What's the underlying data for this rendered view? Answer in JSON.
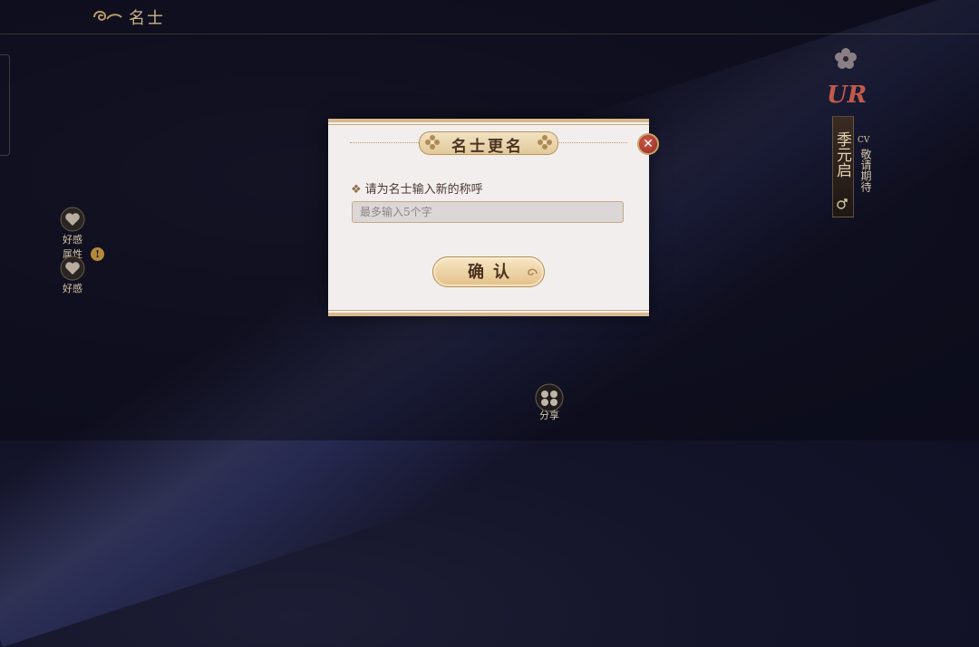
{
  "header": {
    "title": "名士"
  },
  "left_menu": {
    "item1_label": "好感",
    "item2_label": "属性",
    "item3_label": "好感",
    "alert": "!"
  },
  "character": {
    "rarity": "UR",
    "name": "季元启",
    "cv_label": "CV",
    "cv_value": "敬请期待"
  },
  "share": {
    "label": "分享"
  },
  "dialog": {
    "title": "名士更名",
    "prompt": "请为名士输入新的称呼",
    "input_placeholder": "最多输入5个字",
    "input_value": "",
    "confirm_label": "确认"
  },
  "colors": {
    "accent_gold": "#d6b98d",
    "close_red": "#b23a30",
    "rarity_red": "#c25a4a"
  }
}
